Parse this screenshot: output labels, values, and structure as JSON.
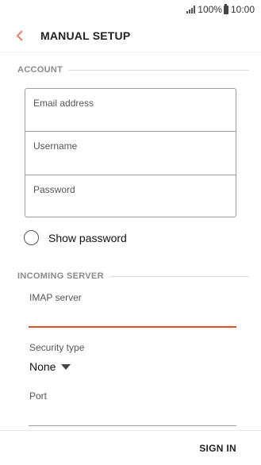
{
  "status_bar": {
    "battery": "100%",
    "time": "10:00"
  },
  "app_bar": {
    "title": "MANUAL SETUP"
  },
  "account_section": {
    "header": "ACCOUNT",
    "fields": [
      {
        "placeholder": "Email address"
      },
      {
        "placeholder": "Username"
      },
      {
        "placeholder": "Password"
      }
    ],
    "show_password_label": "Show password",
    "show_password_checked": false
  },
  "incoming_section": {
    "header": "INCOMING SERVER",
    "imap_label": "IMAP server",
    "security_label": "Security type",
    "security_value": "None",
    "port_label": "Port"
  },
  "bottom_bar": {
    "sign_in_label": "SIGN IN"
  },
  "colors": {
    "accent": "#e05030",
    "back_arrow": "#e8825e"
  }
}
